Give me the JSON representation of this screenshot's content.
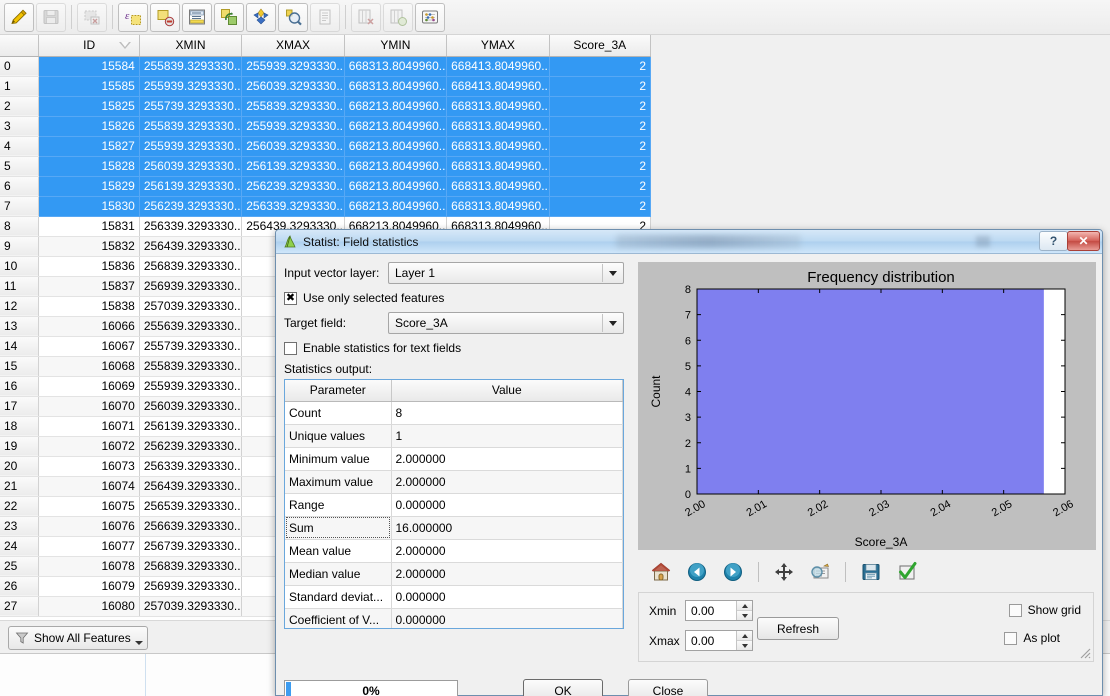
{
  "toolbar": {
    "buttons": [
      {
        "name": "toggle-editing",
        "icon": "pencil-icon",
        "enabled": true
      },
      {
        "name": "save-edits",
        "icon": "floppy-disk-icon",
        "enabled": false
      },
      {
        "name": "delete-selected",
        "icon": "delete-selected-icon",
        "enabled": false
      },
      {
        "name": "select-by-expression",
        "icon": "epsilon-select-icon",
        "enabled": true
      },
      {
        "name": "deselect-all",
        "icon": "deselect-icon",
        "enabled": true
      },
      {
        "name": "move-selection-to-top",
        "icon": "move-selection-top-icon",
        "enabled": true
      },
      {
        "name": "invert-selection",
        "icon": "invert-selection-icon",
        "enabled": true
      },
      {
        "name": "pan-map-to-selected",
        "icon": "pan-to-selection-icon",
        "enabled": true
      },
      {
        "name": "zoom-map-to-selected",
        "icon": "zoom-to-selection-icon",
        "enabled": true
      },
      {
        "name": "copy-selected-rows",
        "icon": "copy-rows-icon",
        "enabled": false
      },
      {
        "name": "delete-column",
        "icon": "delete-column-icon",
        "enabled": false
      },
      {
        "name": "new-column",
        "icon": "new-column-icon",
        "enabled": false
      },
      {
        "name": "open-field-calculator",
        "icon": "field-calculator-icon",
        "enabled": true
      }
    ]
  },
  "table": {
    "columns": [
      "ID",
      "XMIN",
      "XMAX",
      "YMIN",
      "YMAX",
      "Score_3A"
    ],
    "sorted_column": "ID",
    "rows": [
      {
        "index": "0",
        "selected": true,
        "cells": [
          "15584",
          "255839.3293330...",
          "255939.3293330...",
          "668313.8049960...",
          "668413.8049960...",
          "2"
        ]
      },
      {
        "index": "1",
        "selected": true,
        "cells": [
          "15585",
          "255939.3293330...",
          "256039.3293330...",
          "668313.8049960...",
          "668413.8049960...",
          "2"
        ]
      },
      {
        "index": "2",
        "selected": true,
        "cells": [
          "15825",
          "255739.3293330...",
          "255839.3293330...",
          "668213.8049960...",
          "668313.8049960...",
          "2"
        ]
      },
      {
        "index": "3",
        "selected": true,
        "cells": [
          "15826",
          "255839.3293330...",
          "255939.3293330...",
          "668213.8049960...",
          "668313.8049960...",
          "2"
        ]
      },
      {
        "index": "4",
        "selected": true,
        "cells": [
          "15827",
          "255939.3293330...",
          "256039.3293330...",
          "668213.8049960...",
          "668313.8049960...",
          "2"
        ]
      },
      {
        "index": "5",
        "selected": true,
        "cells": [
          "15828",
          "256039.3293330...",
          "256139.3293330...",
          "668213.8049960...",
          "668313.8049960...",
          "2"
        ]
      },
      {
        "index": "6",
        "selected": true,
        "cells": [
          "15829",
          "256139.3293330...",
          "256239.3293330...",
          "668213.8049960...",
          "668313.8049960...",
          "2"
        ]
      },
      {
        "index": "7",
        "selected": true,
        "cells": [
          "15830",
          "256239.3293330...",
          "256339.3293330...",
          "668213.8049960...",
          "668313.8049960...",
          "2"
        ]
      },
      {
        "index": "8",
        "selected": false,
        "cells": [
          "15831",
          "256339.3293330...",
          "256439.3293330...",
          "668213.8049960...",
          "668313.8049960...",
          "2"
        ]
      },
      {
        "index": "9",
        "selected": false,
        "cells": [
          "15832",
          "256439.3293330...",
          "25653",
          "",
          "",
          ""
        ]
      },
      {
        "index": "10",
        "selected": false,
        "cells": [
          "15836",
          "256839.3293330...",
          "25693",
          "",
          "",
          ""
        ]
      },
      {
        "index": "11",
        "selected": false,
        "cells": [
          "15837",
          "256939.3293330...",
          "25703",
          "",
          "",
          ""
        ]
      },
      {
        "index": "12",
        "selected": false,
        "cells": [
          "15838",
          "257039.3293330...",
          "25713",
          "",
          "",
          ""
        ]
      },
      {
        "index": "13",
        "selected": false,
        "cells": [
          "16066",
          "255639.3293330...",
          "25573",
          "",
          "",
          ""
        ]
      },
      {
        "index": "14",
        "selected": false,
        "cells": [
          "16067",
          "255739.3293330...",
          "25583",
          "",
          "",
          ""
        ]
      },
      {
        "index": "15",
        "selected": false,
        "cells": [
          "16068",
          "255839.3293330...",
          "25593",
          "",
          "",
          ""
        ]
      },
      {
        "index": "16",
        "selected": false,
        "cells": [
          "16069",
          "255939.3293330...",
          "25603",
          "",
          "",
          ""
        ]
      },
      {
        "index": "17",
        "selected": false,
        "cells": [
          "16070",
          "256039.3293330...",
          "25613",
          "",
          "",
          ""
        ]
      },
      {
        "index": "18",
        "selected": false,
        "cells": [
          "16071",
          "256139.3293330...",
          "25623",
          "",
          "",
          ""
        ]
      },
      {
        "index": "19",
        "selected": false,
        "cells": [
          "16072",
          "256239.3293330...",
          "25633",
          "",
          "",
          ""
        ]
      },
      {
        "index": "20",
        "selected": false,
        "cells": [
          "16073",
          "256339.3293330...",
          "25643",
          "",
          "",
          ""
        ]
      },
      {
        "index": "21",
        "selected": false,
        "cells": [
          "16074",
          "256439.3293330...",
          "25653",
          "",
          "",
          ""
        ]
      },
      {
        "index": "22",
        "selected": false,
        "cells": [
          "16075",
          "256539.3293330...",
          "25663",
          "",
          "",
          ""
        ]
      },
      {
        "index": "23",
        "selected": false,
        "cells": [
          "16076",
          "256639.3293330...",
          "25673",
          "",
          "",
          ""
        ]
      },
      {
        "index": "24",
        "selected": false,
        "cells": [
          "16077",
          "256739.3293330...",
          "25683",
          "",
          "",
          ""
        ]
      },
      {
        "index": "25",
        "selected": false,
        "cells": [
          "16078",
          "256839.3293330...",
          "25693",
          "",
          "",
          ""
        ]
      },
      {
        "index": "26",
        "selected": false,
        "cells": [
          "16079",
          "256939.3293330...",
          "25703",
          "",
          "",
          ""
        ]
      },
      {
        "index": "27",
        "selected": false,
        "cells": [
          "16080",
          "257039.3293330...",
          "25713",
          "",
          "",
          ""
        ]
      }
    ]
  },
  "attr_bottom": {
    "show_all_features_label": "Show All Features"
  },
  "dialog": {
    "title": "Statist: Field statistics",
    "help_label": "?",
    "close_label": "✕",
    "input_layer_label": "Input vector layer:",
    "input_layer_value": "Layer 1",
    "use_selected_label": "Use only selected features",
    "use_selected_checked": true,
    "target_field_label": "Target field:",
    "target_field_value": "Score_3A",
    "text_fields_label": "Enable statistics for text fields",
    "text_fields_checked": false,
    "stats_output_label": "Statistics output:",
    "stats_headers": [
      "Parameter",
      "Value"
    ],
    "stats_rows": [
      {
        "parameter": "Count",
        "value": "8"
      },
      {
        "parameter": "Unique values",
        "value": "1"
      },
      {
        "parameter": "Minimum value",
        "value": "2.000000"
      },
      {
        "parameter": "Maximum value",
        "value": "2.000000"
      },
      {
        "parameter": "Range",
        "value": "0.000000"
      },
      {
        "parameter": "Sum",
        "value": "16.000000"
      },
      {
        "parameter": "Mean value",
        "value": "2.000000"
      },
      {
        "parameter": "Median value",
        "value": "2.000000"
      },
      {
        "parameter": "Standard deviat...",
        "value": "0.000000"
      },
      {
        "parameter": "Coefficient of V...",
        "value": "0.000000"
      }
    ],
    "progress_label": "0%",
    "progress_percent": 0,
    "ok_label": "OK",
    "close_button_label": "Close",
    "nav_buttons": [
      {
        "name": "home",
        "icon": "home-icon"
      },
      {
        "name": "back",
        "icon": "arrow-left-icon"
      },
      {
        "name": "forward",
        "icon": "arrow-right-icon"
      },
      {
        "name": "pan",
        "icon": "move-cross-icon"
      },
      {
        "name": "zoom-rect",
        "icon": "zoom-rect-icon"
      },
      {
        "name": "save-figure",
        "icon": "floppy-disk-icon"
      },
      {
        "name": "apply",
        "icon": "green-check-icon"
      }
    ],
    "xmin_label": "Xmin",
    "xmin_value": "0.00",
    "xmax_label": "Xmax",
    "xmax_value": "0.00",
    "refresh_label": "Refresh",
    "show_grid_label": "Show grid",
    "show_grid_checked": false,
    "as_plot_label": "As plot",
    "as_plot_checked": false
  },
  "colors": {
    "selection_blue": "#3399f3",
    "bar_fill": "#7f7fef",
    "plot_bg": "#bfbfbf",
    "title_bar": "#bcd9f2",
    "close_red": "#c44b43"
  },
  "chart_data": {
    "type": "bar",
    "title": "Frequency distribution",
    "xlabel": "Score_3A",
    "ylabel": "Count",
    "xlim": [
      2.0,
      2.06
    ],
    "ylim": [
      0,
      8
    ],
    "xticks": [
      "2.00",
      "2.01",
      "2.02",
      "2.03",
      "2.04",
      "2.05",
      "2.06"
    ],
    "xtick_values": [
      2.0,
      2.01,
      2.02,
      2.03,
      2.04,
      2.05,
      2.06
    ],
    "yticks": [
      "0",
      "1",
      "2",
      "3",
      "4",
      "5",
      "6",
      "7",
      "8"
    ],
    "ytick_values": [
      0,
      1,
      2,
      3,
      4,
      5,
      6,
      7,
      8
    ],
    "grid": false,
    "legend": null,
    "bars": [
      {
        "x_start": 2.0,
        "x_end": 2.0565,
        "height": 8,
        "color": "#7f7fef"
      }
    ],
    "categories": [
      "2.000"
    ],
    "values": [
      8
    ]
  }
}
